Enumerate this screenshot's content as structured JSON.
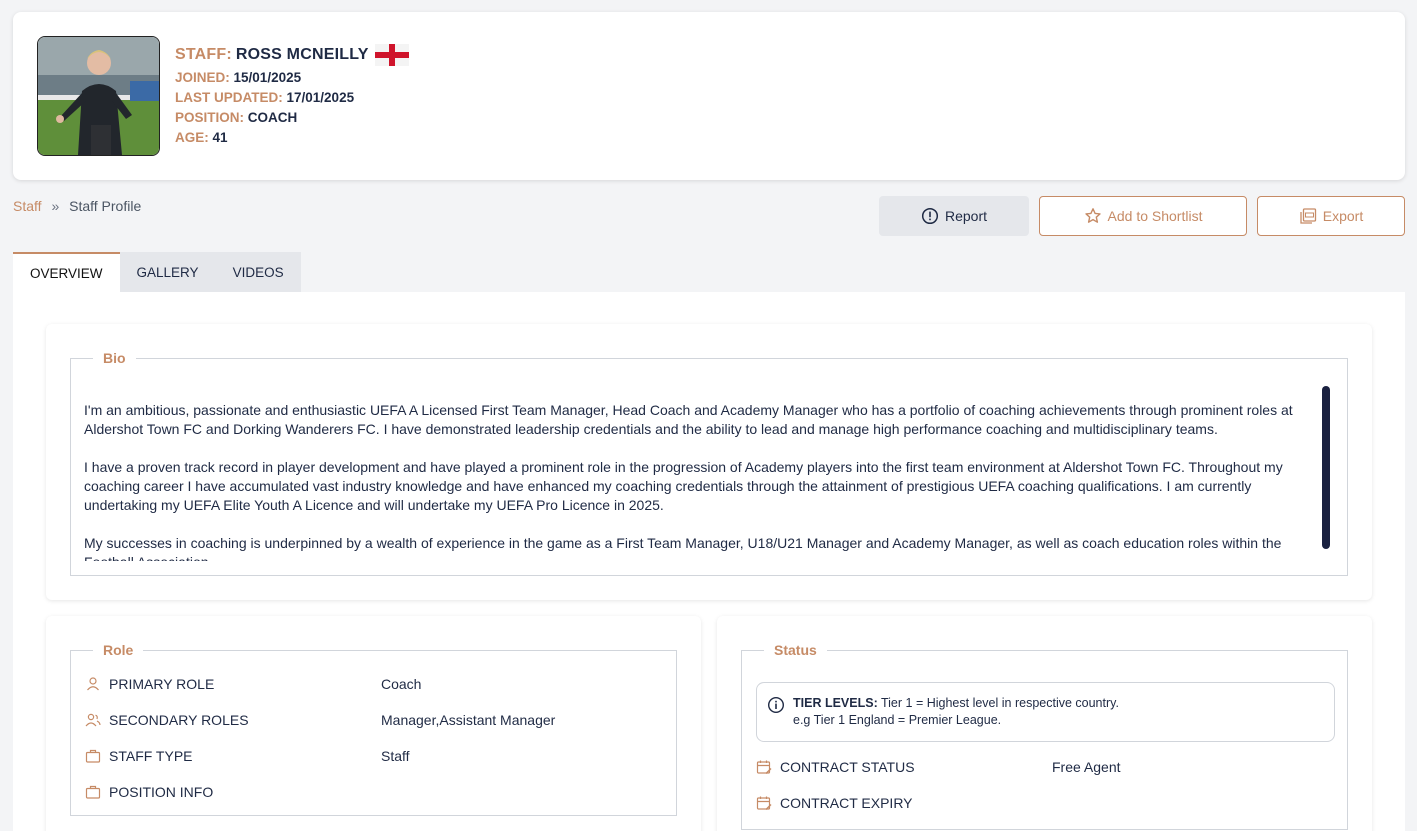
{
  "header": {
    "staff_label": "STAFF:",
    "name": "ROSS MCNEILLY",
    "flag_icon": "england-flag-icon",
    "joined_label": "JOINED:",
    "joined_value": "15/01/2025",
    "updated_label": "LAST UPDATED:",
    "updated_value": "17/01/2025",
    "position_label": "POSITION:",
    "position_value": "COACH",
    "age_label": "AGE:",
    "age_value": "41"
  },
  "breadcrumb": {
    "root": "Staff",
    "separator": "»",
    "current": "Staff Profile"
  },
  "actions": {
    "report": "Report",
    "shortlist": "Add to Shortlist",
    "export": "Export"
  },
  "tabs": {
    "overview": "OVERVIEW",
    "gallery": "GALLERY",
    "videos": "VIDEOS"
  },
  "bio": {
    "legend": "Bio",
    "p1": "I'm an ambitious, passionate and enthusiastic UEFA A Licensed First Team Manager, Head Coach and Academy Manager who has a portfolio of coaching achievements through prominent roles at Aldershot Town FC and Dorking Wanderers FC. I have demonstrated leadership credentials and the ability to lead and manage high performance coaching and multidisciplinary teams.",
    "p2": "I have a proven track record in player development and have played a prominent role in the progression of Academy players into the first team environment at Aldershot Town FC. Throughout my coaching career I have accumulated vast industry knowledge and have enhanced my coaching credentials through the attainment of prestigious UEFA coaching qualifications. I am currently undertaking my UEFA Elite Youth A Licence and will undertake my UEFA Pro Licence in 2025.",
    "p3": "My successes in coaching is underpinned by a wealth of experience in the game as a First Team Manager, U18/U21 Manager and Academy Manager, as well as coach education roles within the Football Association."
  },
  "role": {
    "legend": "Role",
    "primary_label": "PRIMARY ROLE",
    "primary_value": "Coach",
    "secondary_label": "SECONDARY ROLES",
    "secondary_value": "Manager,Assistant Manager",
    "type_label": "STAFF TYPE",
    "type_value": "Staff",
    "position_label": "POSITION INFO",
    "position_value": ""
  },
  "status": {
    "legend": "Status",
    "tier_title": "TIER LEVELS:",
    "tier_text": " Tier 1 = Highest level in respective country.",
    "tier_example": "e.g Tier 1 England = Premier League.",
    "contract_status_label": "CONTRACT STATUS",
    "contract_status_value": "Free Agent",
    "contract_expiry_label": "CONTRACT EXPIRY",
    "contract_expiry_value": ""
  },
  "colors": {
    "accent": "#c68b66",
    "navy": "#1f2a44",
    "scrollbar": "#1a2140"
  }
}
